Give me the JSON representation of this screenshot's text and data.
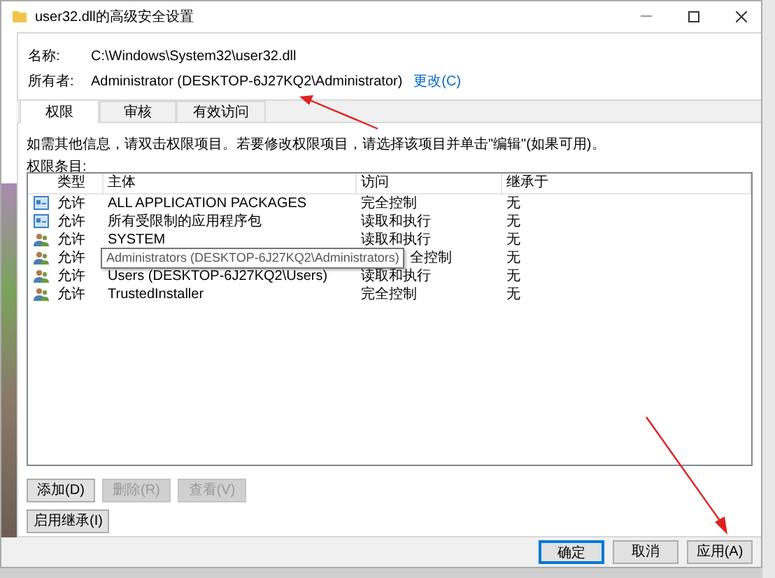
{
  "window": {
    "title": "user32.dll的高级安全设置"
  },
  "info": [
    {
      "label": "名称:",
      "value": "C:\\Windows\\System32\\user32.dll"
    },
    {
      "label": "所有者:",
      "value": "Administrator (DESKTOP-6J27KQ2\\Administrator)",
      "link": "更改(C)"
    }
  ],
  "tabs": [
    {
      "label": "权限",
      "selected": true
    },
    {
      "label": "审核",
      "selected": false
    },
    {
      "label": "有效访问",
      "selected": false
    }
  ],
  "description": "如需其他信息，请双击权限项目。若要修改权限项目，请选择该项目并单击\"编辑\"(如果可用)。",
  "entries_label": "权限条目:",
  "table": {
    "columns": [
      "类型",
      "主体",
      "访问",
      "继承于"
    ],
    "rows": [
      {
        "kind": "package",
        "type": "允许",
        "principal": "ALL APPLICATION PACKAGES",
        "access": "完全控制",
        "inherited": "无"
      },
      {
        "kind": "package",
        "type": "允许",
        "principal": "所有受限制的应用程序包",
        "access": "读取和执行",
        "inherited": "无"
      },
      {
        "kind": "users",
        "type": "允许",
        "principal": "SYSTEM",
        "access": "读取和执行",
        "inherited": "无"
      },
      {
        "kind": "users",
        "type": "允许",
        "access": "全控制",
        "inherited": "无",
        "tooltip": "Administrators (DESKTOP-6J27KQ2\\Administrators)"
      },
      {
        "kind": "users",
        "type": "允许",
        "principal": "Users (DESKTOP-6J27KQ2\\Users)",
        "access": "读取和执行",
        "inherited": "无"
      },
      {
        "kind": "users",
        "type": "允许",
        "principal": "TrustedInstaller",
        "access": "完全控制",
        "inherited": "无"
      }
    ]
  },
  "entry_buttons": [
    {
      "label": "添加(D)",
      "disabled": false
    },
    {
      "label": "删除(R)",
      "disabled": true
    },
    {
      "label": "查看(V)",
      "disabled": true
    }
  ],
  "inheritance_button": {
    "label": "启用继承(I)",
    "disabled": false
  },
  "dialog_buttons": [
    {
      "label": "确定",
      "default": true
    },
    {
      "label": "取消",
      "default": false
    },
    {
      "label": "应用(A)",
      "default": false
    }
  ]
}
